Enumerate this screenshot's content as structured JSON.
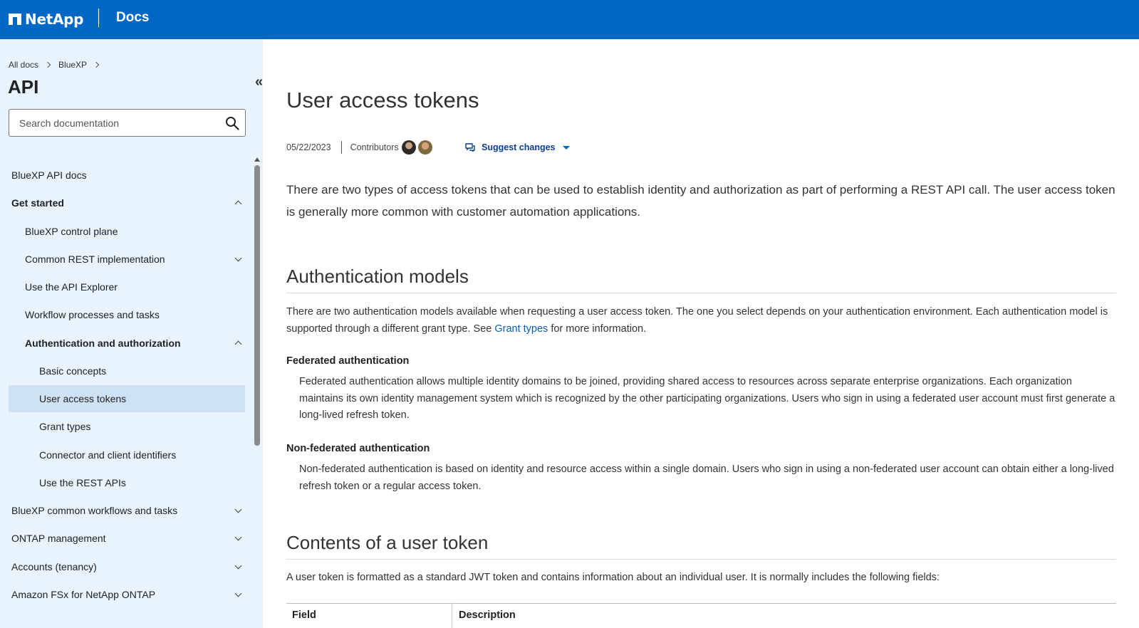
{
  "header": {
    "logo_text": "NetApp",
    "docs_label": "Docs",
    "brand_color": "#0067c5"
  },
  "sidebar": {
    "breadcrumb": [
      "All docs",
      "BlueXP"
    ],
    "title": "API",
    "search_placeholder": "Search documentation",
    "collapse_glyph": "«",
    "items": [
      {
        "label": "BlueXP API docs",
        "level": 0,
        "chevron": "none"
      },
      {
        "label": "Get started",
        "level": 0,
        "chevron": "up",
        "bold": true
      },
      {
        "label": "BlueXP control plane",
        "level": 1,
        "chevron": "none"
      },
      {
        "label": "Common REST implementation",
        "level": 1,
        "chevron": "down"
      },
      {
        "label": "Use the API Explorer",
        "level": 1,
        "chevron": "none"
      },
      {
        "label": "Workflow processes and tasks",
        "level": 1,
        "chevron": "none"
      },
      {
        "label": "Authentication and authorization",
        "level": 1,
        "chevron": "up",
        "bold": true
      },
      {
        "label": "Basic concepts",
        "level": 2,
        "chevron": "none"
      },
      {
        "label": "User access tokens",
        "level": 2,
        "chevron": "none",
        "active": true
      },
      {
        "label": "Grant types",
        "level": 2,
        "chevron": "none"
      },
      {
        "label": "Connector and client identifiers",
        "level": 2,
        "chevron": "none"
      },
      {
        "label": "Use the REST APIs",
        "level": 2,
        "chevron": "none"
      },
      {
        "label": "BlueXP common workflows and tasks",
        "level": 0,
        "chevron": "down"
      },
      {
        "label": "ONTAP management",
        "level": 0,
        "chevron": "down"
      },
      {
        "label": "Accounts (tenancy)",
        "level": 0,
        "chevron": "down"
      },
      {
        "label": "Amazon FSx for NetApp ONTAP",
        "level": 0,
        "chevron": "down"
      }
    ]
  },
  "main": {
    "title": "User access tokens",
    "date": "05/22/2023",
    "contributors_label": "Contributors",
    "suggest_label": "Suggest changes",
    "intro": "There are two types of access tokens that can be used to establish identity and authorization as part of performing a REST API call. The user access token is generally more common with customer automation applications.",
    "section1": {
      "heading": "Authentication models",
      "para_before_link": "There are two authentication models available when requesting a user access token. The one you select depends on your authentication environment. Each authentication model is supported through a different grant type. See ",
      "link_text": "Grant types",
      "para_after_link": " for more information.",
      "federated_title": "Federated authentication",
      "federated_text": "Federated authentication allows multiple identity domains to be joined, providing shared access to resources across separate enterprise organizations. Each organization maintains its own identity management system which is recognized by the other participating organizations. Users who sign in using a federated user account must first generate a long-lived refresh token.",
      "nonfederated_title": "Non-federated authentication",
      "nonfederated_text": "Non-federated authentication is based on identity and resource access within a single domain. Users who sign in using a non-federated user account can obtain either a long-lived refresh token or a regular access token."
    },
    "section2": {
      "heading": "Contents of a user token",
      "para": "A user token is formatted as a standard JWT token and contains information about an individual user. It is normally includes the following fields:",
      "table_headers": [
        "Field",
        "Description"
      ]
    }
  }
}
